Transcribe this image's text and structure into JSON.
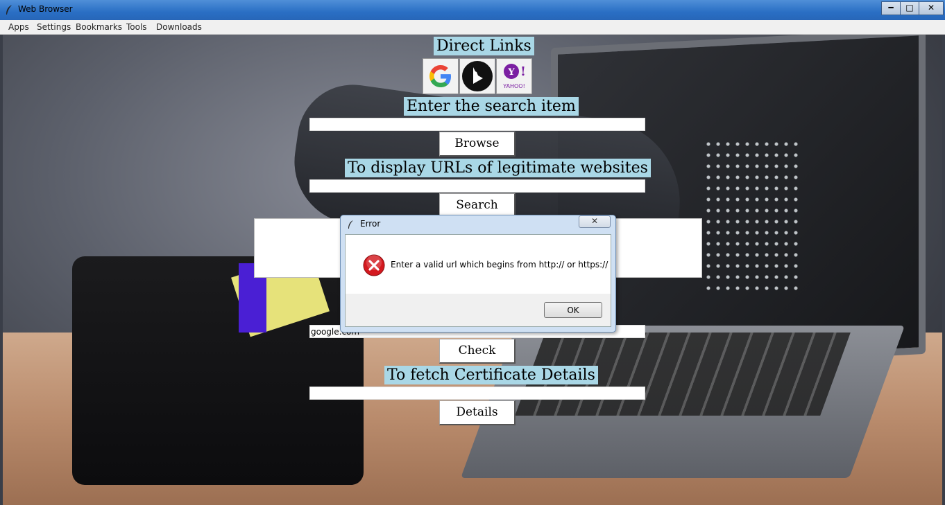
{
  "window": {
    "title": "Web Browser",
    "controls": {
      "minimize": "━",
      "maximize": "□",
      "close": "✕"
    }
  },
  "menubar": {
    "items": [
      "Apps",
      "Settings",
      "Bookmarks",
      "Tools",
      "Downloads"
    ]
  },
  "main": {
    "direct_links_label": "Direct Links",
    "direct_links": [
      {
        "name": "Google",
        "icon": "google-icon"
      },
      {
        "name": "Bing",
        "icon": "bing-icon"
      },
      {
        "name": "Yahoo",
        "icon": "yahoo-icon",
        "text": "YAHOO!"
      }
    ],
    "search_label": "Enter the search item",
    "search_value": "",
    "browse_button": "Browse",
    "legit_label": "To display URLs of legitimate websites",
    "legit_value": "",
    "search_button": "Search",
    "check_value": "google.com",
    "check_button": "Check",
    "cert_label": "To fetch Certificate Details",
    "cert_value": "",
    "details_button": "Details"
  },
  "dialog": {
    "title": "Error",
    "close": "✕",
    "message": "Enter a valid url which begins from http:// or https://",
    "ok_button": "OK",
    "icon": "error-icon"
  },
  "colors": {
    "label_bg": "#a9d7e6",
    "titlebar": "#2a6fc4",
    "error_red": "#d4191f"
  }
}
